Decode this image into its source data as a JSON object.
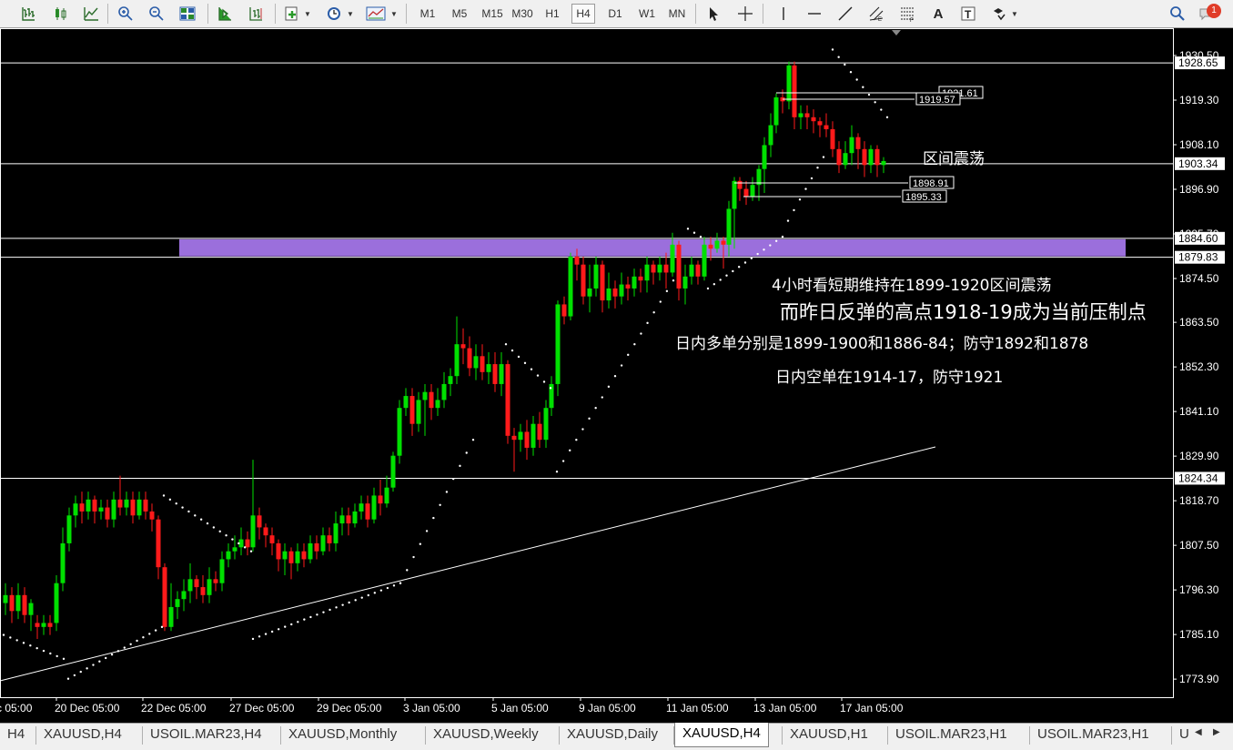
{
  "toolbar": {
    "timeframes": [
      "M1",
      "M5",
      "M15",
      "M30",
      "H1",
      "H4",
      "D1",
      "W1",
      "MN"
    ],
    "active_timeframe": "H4",
    "notification_count": "1"
  },
  "chart": {
    "price_axis_ticks": [
      "1930.50",
      "1919.30",
      "1908.10",
      "1896.90",
      "1885.70",
      "1874.50",
      "1863.50",
      "1852.30",
      "1841.10",
      "1829.90",
      "1818.70",
      "1807.50",
      "1796.30",
      "1785.10",
      "1773.90"
    ],
    "time_axis_ticks": [
      "c 05:00",
      "20 Dec 05:00",
      "22 Dec 05:00",
      "27 Dec 05:00",
      "29 Dec 05:00",
      "3 Jan 05:00",
      "5 Jan 05:00",
      "9 Jan 05:00",
      "11 Jan 05:00",
      "13 Jan 05:00",
      "17 Jan 05:00"
    ],
    "horizontal_levels": [
      "1928.65",
      "1903.34",
      "1884.60",
      "1879.83",
      "1824.34"
    ],
    "segment_labels": [
      "1921.61",
      "1919.57",
      "1898.91",
      "1895.33"
    ],
    "zone": {
      "top": "1884.60",
      "bottom": "1879.83",
      "color": "#9b6fdc"
    },
    "annotations": {
      "range_label": "区间震荡",
      "line1": "4小时看短期维持在1899-1920区间震荡",
      "line2": "而昨日反弹的高点1918-19成为当前压制点",
      "line3": "日内多单分别是1899-1900和1886-84；防守1892和1878",
      "line4": "日内空单在1914-17，防守1921"
    },
    "colors": {
      "bull": "#00e000",
      "bear": "#ff1a1a",
      "background": "#000000",
      "foreground": "#ffffff"
    }
  },
  "tabs": [
    {
      "label": "H4"
    },
    {
      "label": "XAUUSD,H4"
    },
    {
      "label": "USOIL.MAR23,H4"
    },
    {
      "label": "XAUUSD,Monthly"
    },
    {
      "label": "XAUUSD,Weekly"
    },
    {
      "label": "XAUUSD,Daily"
    },
    {
      "label": "XAUUSD,H4",
      "active": true
    },
    {
      "label": "XAUUSD,H1"
    },
    {
      "label": "USOIL.MAR23,H1"
    },
    {
      "label": "USOIL.MAR23,H1"
    },
    {
      "label": "U"
    }
  ]
}
